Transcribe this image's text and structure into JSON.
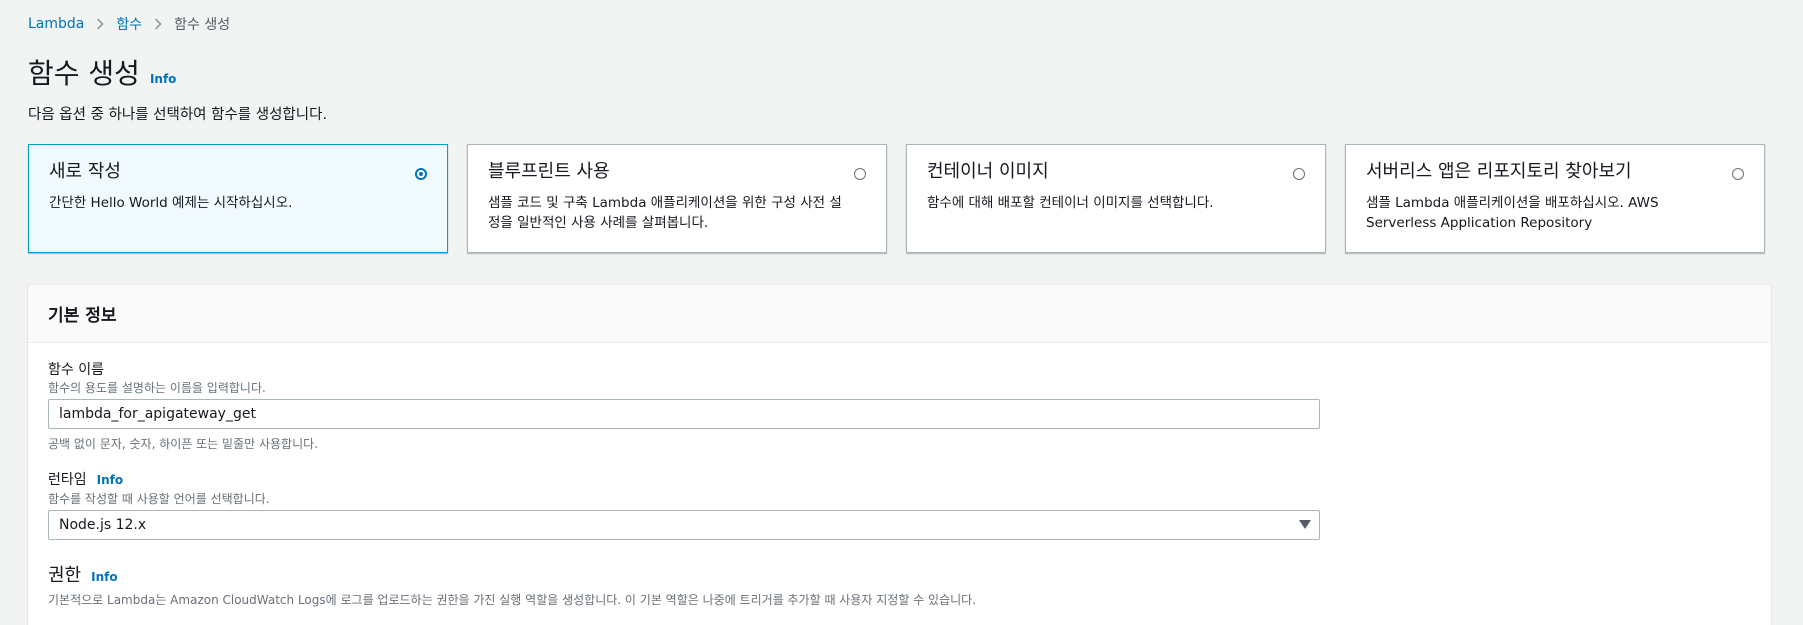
{
  "breadcrumb": {
    "items": [
      "Lambda",
      "함수"
    ],
    "current": "함수 생성"
  },
  "page": {
    "title": "함수 생성",
    "info": "Info",
    "subtitle": "다음 옵션 중 하나를 선택하여 함수를 생성합니다."
  },
  "options": [
    {
      "title": "새로 작성",
      "desc": "간단한 Hello World 예제는 시작하십시오.",
      "selected": true
    },
    {
      "title": "블루프린트 사용",
      "desc": "샘플 코드 및 구축 Lambda 애플리케이션을 위한 구성 사전 설정을 일반적인 사용 사례를 살펴봅니다.",
      "selected": false
    },
    {
      "title": "컨테이너 이미지",
      "desc": "함수에 대해 배포할 컨테이너 이미지를 선택합니다.",
      "selected": false
    },
    {
      "title": "서버리스 앱은 리포지토리 찾아보기",
      "desc": "샘플 Lambda 애플리케이션을 배포하십시오. AWS Serverless Application Repository",
      "selected": false
    }
  ],
  "basic_info": {
    "header": "기본 정보",
    "function_name": {
      "label": "함수 이름",
      "description": "함수의 용도를 설명하는 이름을 입력합니다.",
      "value": "lambda_for_apigateway_get",
      "hint": "공백 없이 문자, 숫자, 하이픈 또는 밑줄만 사용합니다."
    },
    "runtime": {
      "label": "런타임",
      "info": "Info",
      "description": "함수를 작성할 때 사용할 언어를 선택합니다.",
      "value": "Node.js 12.x"
    },
    "permissions": {
      "label": "권한",
      "info": "Info",
      "description": "기본적으로 Lambda는 Amazon CloudWatch Logs에 로그를 업로드하는 권한을 가진 실행 역할을 생성합니다. 이 기본 역할은 나중에 트리거를 추가할 때 사용자 지정할 수 있습니다."
    }
  },
  "colors": {
    "link": "#0073bb",
    "selected_border": "#00a1c9",
    "selected_bg": "#f1faff",
    "page_bg": "#f2f3f3"
  }
}
